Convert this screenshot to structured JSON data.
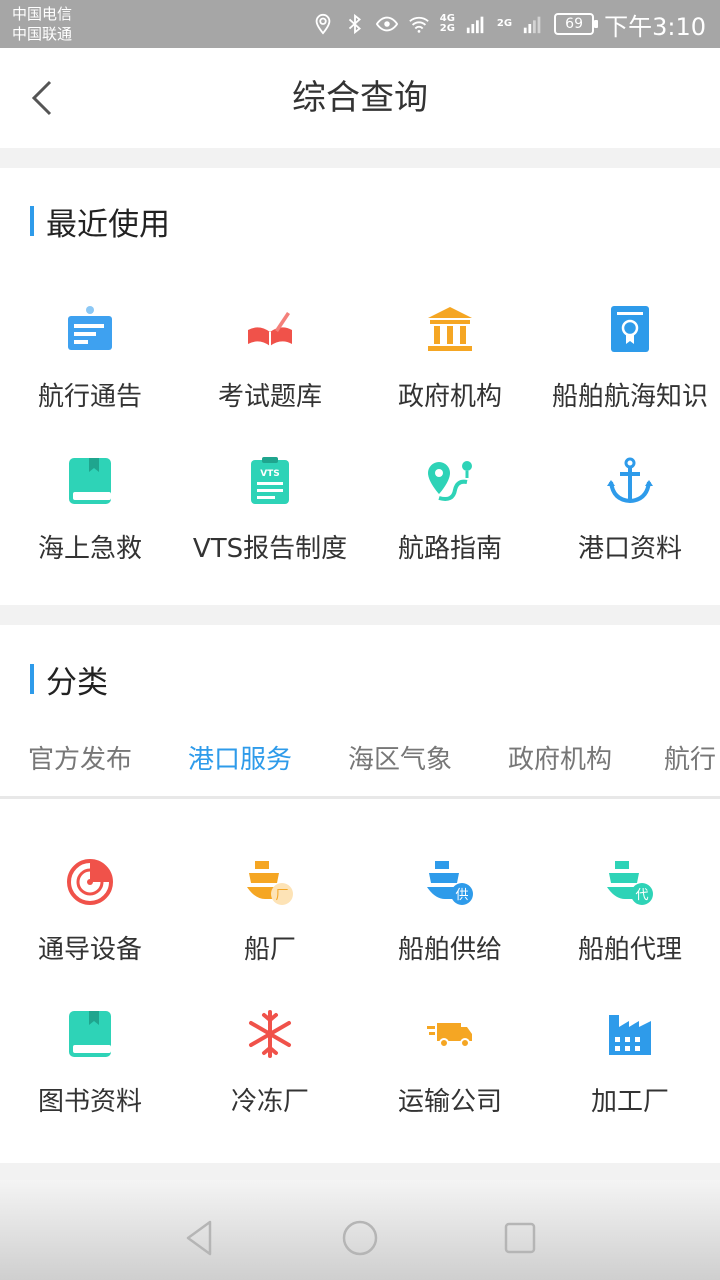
{
  "status_bar": {
    "carrier1": "中国电信",
    "carrier2": "中国联通",
    "net1": "4G",
    "net2": "2G",
    "net3": "2G",
    "battery": "69",
    "time": "下午3:10"
  },
  "header": {
    "title": "综合查询"
  },
  "recent": {
    "title": "最近使用",
    "items": [
      {
        "label": "航行通告",
        "icon": "notice-board-icon",
        "color": "#3ea1f0"
      },
      {
        "label": "考试题库",
        "icon": "open-book-pen-icon",
        "color": "#f0524a"
      },
      {
        "label": "政府机构",
        "icon": "government-building-icon",
        "color": "#f5a623"
      },
      {
        "label": "船舶航海知识",
        "icon": "certificate-icon",
        "color": "#2e9bea"
      },
      {
        "label": "海上急救",
        "icon": "book-icon",
        "color": "#2ed3b7"
      },
      {
        "label": "VTS报告制度",
        "icon": "clipboard-vts-icon",
        "color": "#2ed3b7"
      },
      {
        "label": "航路指南",
        "icon": "route-map-icon",
        "color": "#2ed3b7"
      },
      {
        "label": "港口资料",
        "icon": "anchor-icon",
        "color": "#2e9bea"
      }
    ]
  },
  "category": {
    "title": "分类",
    "tabs": [
      "官方发布",
      "港口服务",
      "海区气象",
      "政府机构",
      "航行"
    ],
    "active_tab": 1,
    "items": [
      {
        "label": "通导设备",
        "icon": "radar-icon",
        "color": "#f0524a"
      },
      {
        "label": "船厂",
        "icon": "ship-factory-icon",
        "color": "#f5a623",
        "badge": "厂"
      },
      {
        "label": "船舶供给",
        "icon": "ship-supply-icon",
        "color": "#2e9bea",
        "badge": "供"
      },
      {
        "label": "船舶代理",
        "icon": "ship-agent-icon",
        "color": "#2ed3b7",
        "badge": "代"
      },
      {
        "label": "图书资料",
        "icon": "book-icon",
        "color": "#2ed3b7"
      },
      {
        "label": "冷冻厂",
        "icon": "snowflake-icon",
        "color": "#f0524a"
      },
      {
        "label": "运输公司",
        "icon": "delivery-truck-icon",
        "color": "#f5a623"
      },
      {
        "label": "加工厂",
        "icon": "factory-icon",
        "color": "#2e9bea"
      }
    ]
  },
  "colors": {
    "accent": "#2e9bea",
    "text": "#333333",
    "tab_inactive": "#777777"
  }
}
